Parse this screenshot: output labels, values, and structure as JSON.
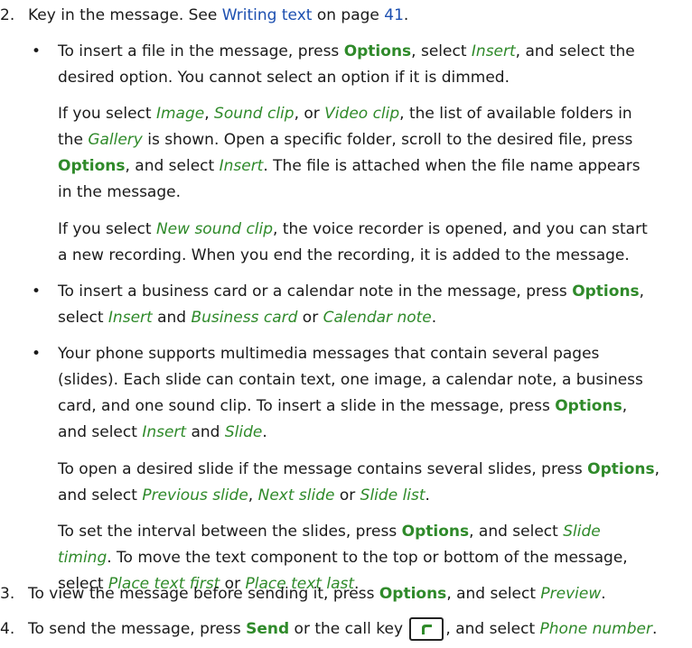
{
  "step2": {
    "number": "2.",
    "line1_a": "Key in the message. See ",
    "line1_link": "Writing text",
    "line1_b": " on page ",
    "line1_page": "41",
    "line1_end": "."
  },
  "bullet_insert_file": {
    "l1_a": "To insert a file in the message, press ",
    "l1_options": "Options",
    "l1_b": ", select ",
    "l1_insert": "Insert",
    "l1_c": ", and select the",
    "l2": "desired option. You cannot select an option if it is dimmed."
  },
  "para_image": {
    "l1_a": "If you select ",
    "image": "Image",
    "l1_b": ", ",
    "sound_clip": "Sound clip",
    "l1_c": ", or ",
    "video_clip": "Video clip",
    "l1_d": ", the list of available folders in",
    "l2_a": "the ",
    "gallery": "Gallery",
    "l2_b": " is shown. Open a specific folder, scroll to the desired file, press",
    "options": "Options",
    "l3_b": ", and select ",
    "insert": "Insert",
    "l3_c": ". The file is attached when the file name appears",
    "l4": "in the message."
  },
  "para_new_sound": {
    "l1_a": "If you select ",
    "new_sound_clip": "New sound clip",
    "l1_b": ", the voice recorder is opened, and you can start",
    "l2": "a new recording. When you end the recording, it is added to the message."
  },
  "bullet_business": {
    "l1_a": "To insert a business card or a calendar note in the message, press ",
    "options": "Options",
    "l1_b": ",",
    "l2_a": "select ",
    "insert": "Insert",
    "l2_b": " and ",
    "business_card": "Business card",
    "l2_c": " or ",
    "calendar_note": "Calendar note",
    "l2_d": "."
  },
  "bullet_slides": {
    "l1": "Your phone supports multimedia messages that contain several pages",
    "l2": "(slides). Each slide can contain text, one image, a calendar note, a business",
    "l3_a": "card, and one sound clip. To insert a slide in the message, press ",
    "options": "Options",
    "l3_b": ",",
    "l4_a": "and select ",
    "insert": "Insert",
    "l4_b": " and ",
    "slide": "Slide",
    "l4_c": "."
  },
  "para_open_slide": {
    "l1_a": "To open a desired slide if the message contains several slides, press ",
    "options": "Options",
    "l1_b": ",",
    "l2_a": "and select ",
    "previous_slide": "Previous slide",
    "l2_b": ", ",
    "next_slide": "Next slide",
    "l2_c": " or ",
    "slide_list": "Slide list",
    "l2_d": "."
  },
  "para_interval": {
    "l1_a": "To set the interval between the slides, press ",
    "options": "Options",
    "l1_b": ", and select ",
    "slide": "Slide",
    "timing": "timing",
    "l2_b": ". To move the text component to the top or bottom of the message,",
    "l3_a": "select ",
    "place_first": "Place text first",
    "l3_b": " or ",
    "place_last": "Place text last",
    "l3_c": "."
  },
  "step3": {
    "number": "3.",
    "a": "To view the message before sending it, press ",
    "options": "Options",
    "b": ", and select ",
    "preview": "Preview",
    "c": "."
  },
  "step4": {
    "number": "4.",
    "a": "To send the message, press ",
    "send": "Send",
    "b": " or the call key ",
    "c": ", and select ",
    "phone_number": "Phone number",
    "d": "."
  },
  "colors": {
    "link": "#1c4fb0",
    "ui_term": "#2f8a2a",
    "text": "#1a1a1a"
  },
  "icons": {
    "call_key": "call-key-icon",
    "bullet": "bullet-dot"
  }
}
